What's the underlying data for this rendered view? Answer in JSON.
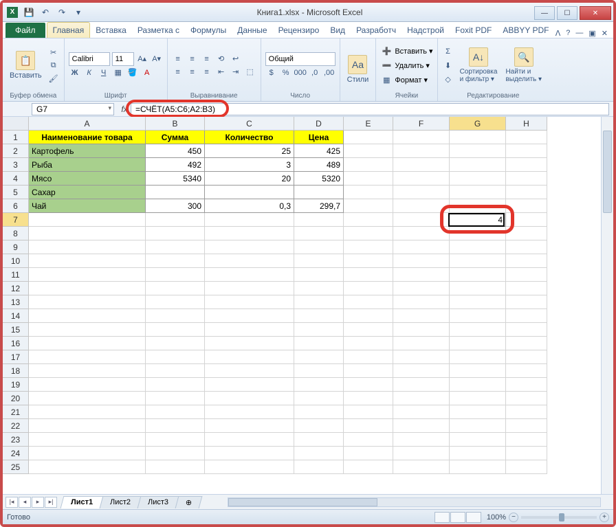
{
  "title": "Книга1.xlsx  -  Microsoft Excel",
  "file_tab": "Файл",
  "tabs": [
    "Главная",
    "Вставка",
    "Разметка с",
    "Формулы",
    "Данные",
    "Рецензиро",
    "Вид",
    "Разработч",
    "Надстрой",
    "Foxit PDF",
    "ABBYY PDF"
  ],
  "ribbon": {
    "clipboard": {
      "paste": "Вставить",
      "label": "Буфер обмена"
    },
    "font": {
      "name": "Calibri",
      "size": "11",
      "label": "Шрифт"
    },
    "align_label": "Выравнивание",
    "number": {
      "format": "Общий",
      "label": "Число"
    },
    "styles_btn": "Стили",
    "cells": {
      "insert": "Вставить ▾",
      "delete": "Удалить ▾",
      "format": "Формат ▾",
      "label": "Ячейки"
    },
    "editing": {
      "sort": "Сортировка\nи фильтр ▾",
      "find": "Найти и\nвыделить ▾",
      "label": "Редактирование"
    }
  },
  "namebox": "G7",
  "formula": "=СЧЁТ(A5:C6;A2:B3)",
  "columns": [
    "A",
    "B",
    "C",
    "D",
    "E",
    "F",
    "G",
    "H"
  ],
  "headers": {
    "a": "Наименование товара",
    "b": "Сумма",
    "c": "Количество",
    "d": "Цена"
  },
  "rows": [
    {
      "a": "Картофель",
      "b": "450",
      "c": "25",
      "d": "425"
    },
    {
      "a": "Рыба",
      "b": "492",
      "c": "3",
      "d": "489"
    },
    {
      "a": "Мясо",
      "b": "5340",
      "c": "20",
      "d": "5320"
    },
    {
      "a": "Сахар",
      "b": "",
      "c": "",
      "d": ""
    },
    {
      "a": "Чай",
      "b": "300",
      "c": "0,3",
      "d": "299,7"
    }
  ],
  "result_g7": "4",
  "sheets": [
    "Лист1",
    "Лист2",
    "Лист3"
  ],
  "status": "Готово",
  "zoom": "100%"
}
